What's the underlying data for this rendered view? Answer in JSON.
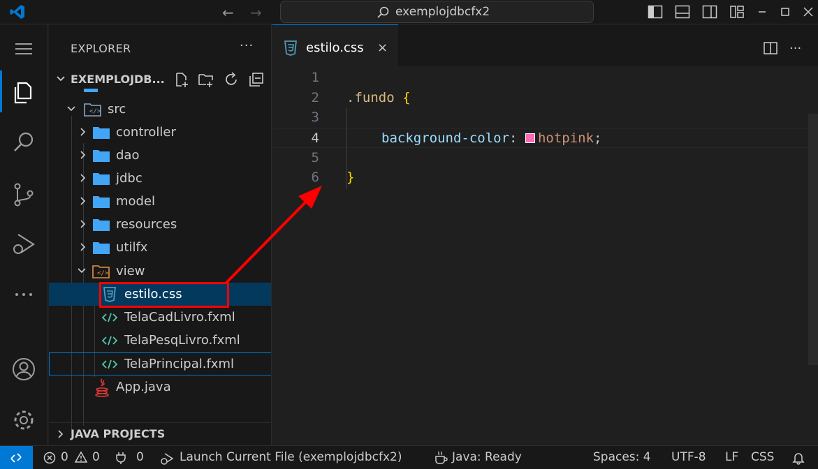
{
  "titlebar": {
    "search_text": "exemplojdbcfx2",
    "nav_back": "←",
    "nav_forward": "→"
  },
  "explorer": {
    "title": "EXPLORER",
    "more": "···",
    "project_name": "EXEMPLOJDB...",
    "bottom_section": "JAVA PROJECTS",
    "tree": [
      {
        "label": "src",
        "kind": "src-folder",
        "expanded": true
      },
      {
        "label": "controller",
        "kind": "folder"
      },
      {
        "label": "dao",
        "kind": "folder"
      },
      {
        "label": "jdbc",
        "kind": "folder"
      },
      {
        "label": "model",
        "kind": "folder"
      },
      {
        "label": "resources",
        "kind": "folder"
      },
      {
        "label": "utilfx",
        "kind": "folder"
      },
      {
        "label": "view",
        "kind": "view-folder",
        "expanded": true
      },
      {
        "label": "estilo.css",
        "kind": "css-file",
        "selected": true
      },
      {
        "label": "TelaCadLivro.fxml",
        "kind": "fxml-file"
      },
      {
        "label": "TelaPesqLivro.fxml",
        "kind": "fxml-file"
      },
      {
        "label": "TelaPrincipal.fxml",
        "kind": "fxml-file",
        "focused": true
      },
      {
        "label": "App.java",
        "kind": "java-file"
      }
    ]
  },
  "editor": {
    "tab_label": "estilo.css",
    "tab_close": "×",
    "actions_more": "···",
    "lines": [
      {
        "num": "1"
      },
      {
        "num": "2",
        "selector": ".fundo",
        "brace": "{"
      },
      {
        "num": "3"
      },
      {
        "num": "4",
        "property": "background-color",
        "colon": ":",
        "value": "hotpink",
        "semi": ";"
      },
      {
        "num": "5"
      },
      {
        "num": "6",
        "brace": "}"
      }
    ]
  },
  "statusbar": {
    "errors": "0",
    "warnings": "0",
    "ports": "0",
    "launch": "Launch Current File (exemplojdbcfx2)",
    "java_status": "Java: Ready",
    "spaces": "Spaces: 4",
    "encoding": "UTF-8",
    "eol": "LF",
    "language": "CSS"
  },
  "colors": {
    "accent": "#0078d4",
    "swatch": "#ff69b4",
    "annotation": "#ff0000",
    "folder": "#42a5f5"
  }
}
